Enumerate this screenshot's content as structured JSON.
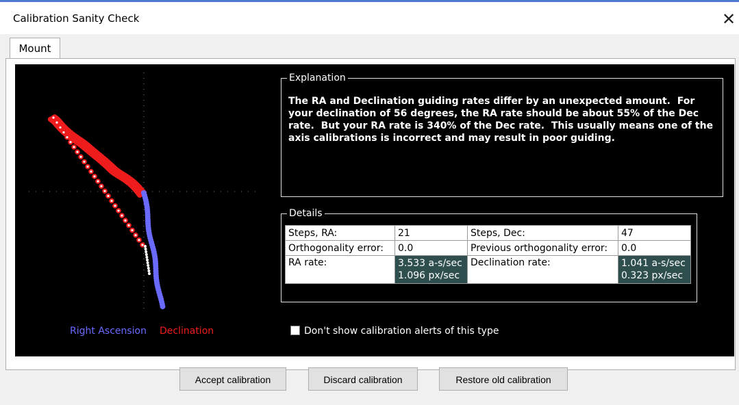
{
  "window": {
    "title": "Calibration Sanity Check",
    "close_glyph": "✕"
  },
  "tabs": [
    {
      "label": "Mount",
      "selected": true
    }
  ],
  "plot": {
    "legend": {
      "ra": {
        "label": "Right Ascension",
        "color": "#6a6aff"
      },
      "dec": {
        "label": "Declination",
        "color": "#ee1c1c"
      }
    }
  },
  "explanation": {
    "title": "Explanation",
    "text": "The RA and Declination guiding rates differ by an unexpected amount.  For your declination of 56 degrees, the RA rate should be about 55% of the Dec rate.  But your RA rate is 340% of the Dec rate.  This usually means one of the axis calibrations is incorrect and may result in poor guiding."
  },
  "details": {
    "title": "Details",
    "rows": [
      [
        {
          "text": "Steps, RA:"
        },
        {
          "text": "21"
        },
        {
          "text": "Steps, Dec:"
        },
        {
          "text": "47"
        }
      ],
      [
        {
          "text": "Orthogonality error:"
        },
        {
          "text": "0.0"
        },
        {
          "text": "Previous orthogonality error:"
        },
        {
          "text": "0.0"
        }
      ],
      [
        {
          "text": "RA rate:"
        },
        {
          "text": "3.533 a-s/sec\n1.096 px/sec",
          "shaded": true
        },
        {
          "text": "Declination rate:"
        },
        {
          "text": "1.041 a-s/sec\n0.323 px/sec",
          "shaded": true
        }
      ]
    ]
  },
  "checkbox": {
    "label": "Don't show calibration alerts of this type",
    "checked": false
  },
  "buttons": {
    "accept": "Accept calibration",
    "discard": "Discard calibration",
    "restore": "Restore old calibration"
  },
  "colors": {
    "ra": "#6a6aff",
    "dec": "#ee1c1c",
    "shaded_cell": "#2f4f4f"
  }
}
